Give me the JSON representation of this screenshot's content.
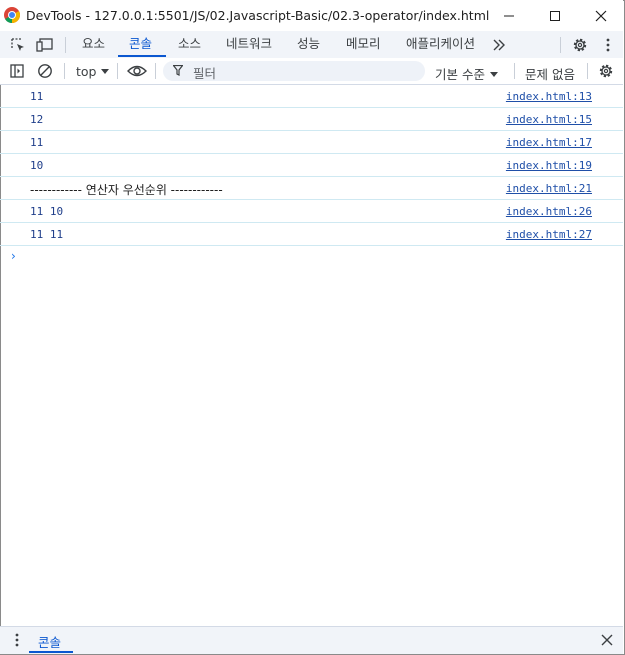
{
  "window": {
    "title": "DevTools - 127.0.0.1:5501/JS/02.Javascript-Basic/02.3-operator/index.html"
  },
  "tabs": [
    {
      "label": "요소"
    },
    {
      "label": "콘솔",
      "active": true
    },
    {
      "label": "소스"
    },
    {
      "label": "네트워크"
    },
    {
      "label": "성능"
    },
    {
      "label": "메모리"
    },
    {
      "label": "애플리케이션"
    }
  ],
  "toolbar": {
    "context": "top",
    "filter_placeholder": "필터",
    "level": "기본 수준",
    "issues": "문제 없음"
  },
  "console": {
    "rows": [
      {
        "text": "11",
        "source": "index.html:13"
      },
      {
        "text": "12",
        "source": "index.html:15"
      },
      {
        "text": "11",
        "source": "index.html:17"
      },
      {
        "text": "10",
        "source": "index.html:19"
      },
      {
        "text": "------------ 연산자 우선순위 ------------",
        "source": "index.html:21"
      },
      {
        "text": "11 10",
        "source": "index.html:26"
      },
      {
        "text": "11 11",
        "source": "index.html:27"
      }
    ],
    "prompt": "›"
  },
  "drawer": {
    "tab": "콘솔"
  },
  "colors": {
    "accent": "#0b57d0",
    "link": "#1f4fa8",
    "value": "#1f3e8a",
    "row_divider": "#cfe9f2"
  }
}
